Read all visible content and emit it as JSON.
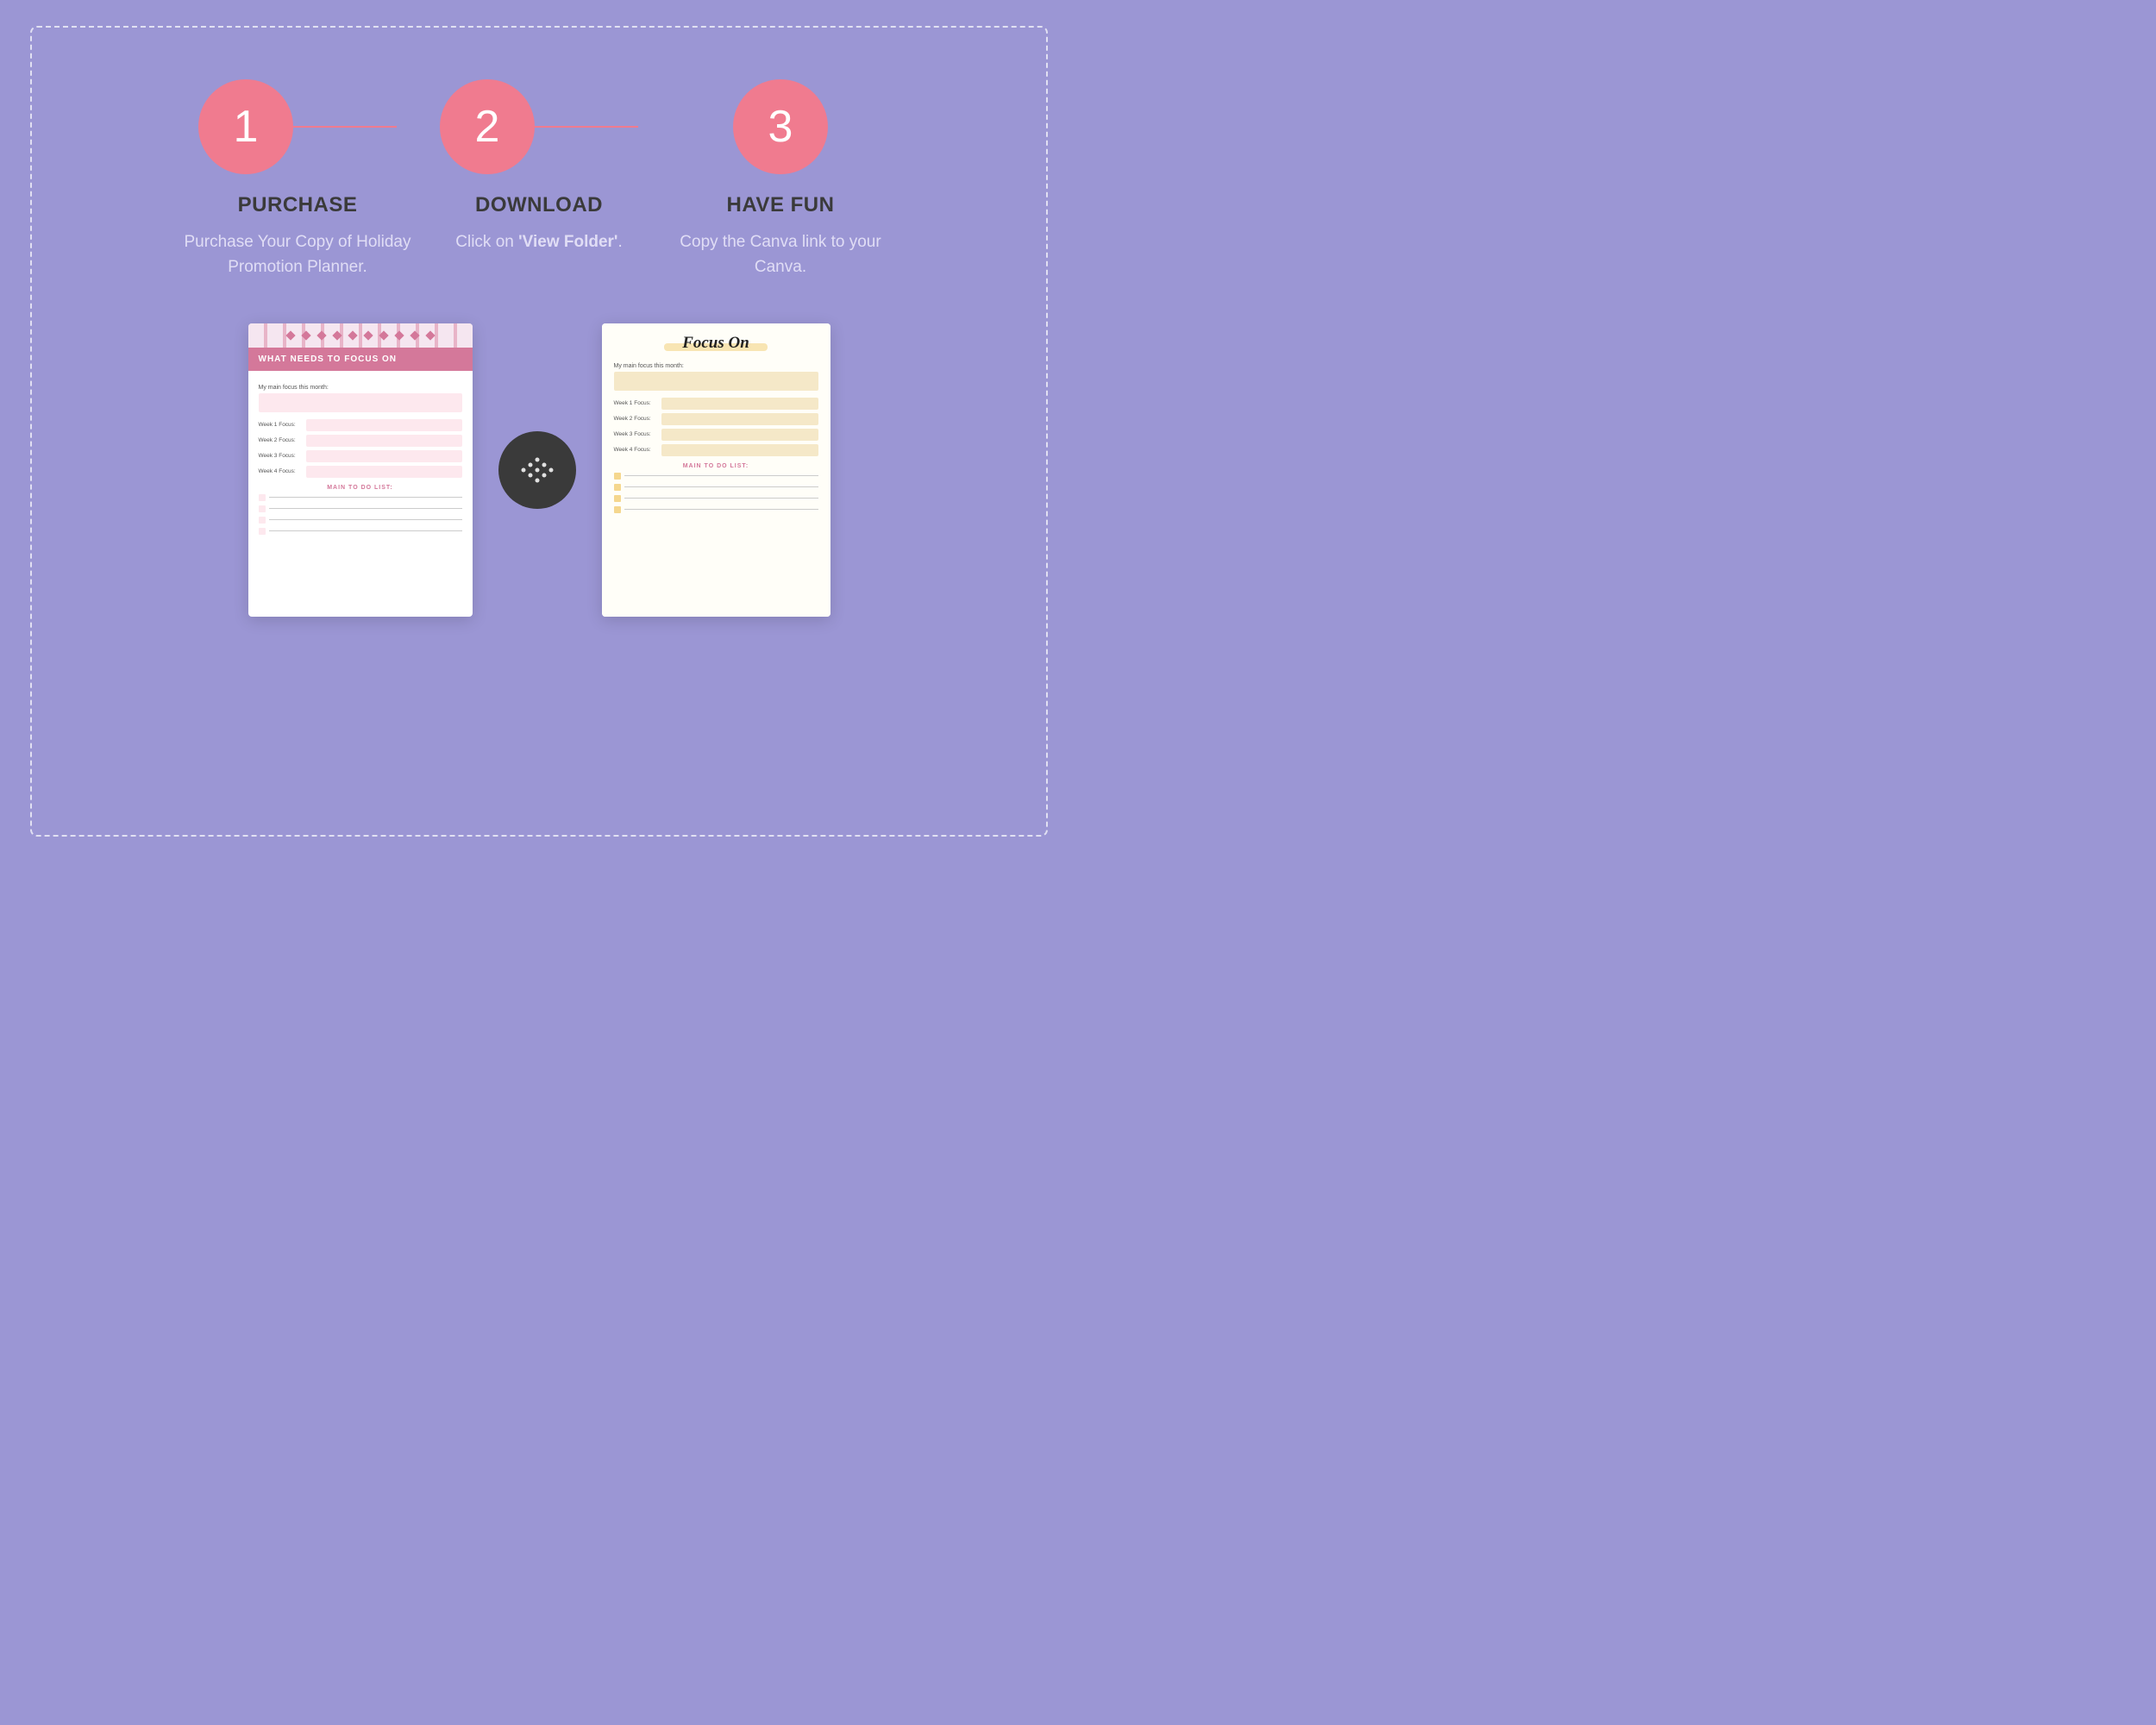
{
  "page": {
    "background_color": "#9b96d4",
    "border_color": "rgba(255,255,255,0.7)"
  },
  "steps": [
    {
      "number": "1",
      "title": "PURCHASE",
      "description": "Purchase Your Copy of Holiday Promotion Planner."
    },
    {
      "number": "2",
      "title": "DOWNLOAD",
      "description_plain": "Click  on ",
      "description_bold": "'View Folder'",
      "description_end": "."
    },
    {
      "number": "3",
      "title": "HAVE FUN",
      "description": "Copy the Canva link to your Canva."
    }
  ],
  "doc_pink": {
    "pattern_label": "pattern",
    "title_bar": "WHAT NEEDS TO FOCUS ON",
    "main_focus_label": "My main focus this month:",
    "week_rows": [
      "Week 1 Focus:",
      "Week 2 Focus:",
      "Week 3 Focus:",
      "Week 4 Focus:"
    ],
    "todo_label": "MAIN TO DO LIST:"
  },
  "arrow": {
    "label": "→"
  },
  "doc_cream": {
    "title": "Focus On",
    "main_focus_label": "My main focus this month:",
    "week_rows": [
      "Week 1 Focus:",
      "Week 2 Focus:",
      "Week 3 Focus:",
      "Week 4 Focus:"
    ],
    "todo_label": "MAIN TO DO LIST:"
  }
}
